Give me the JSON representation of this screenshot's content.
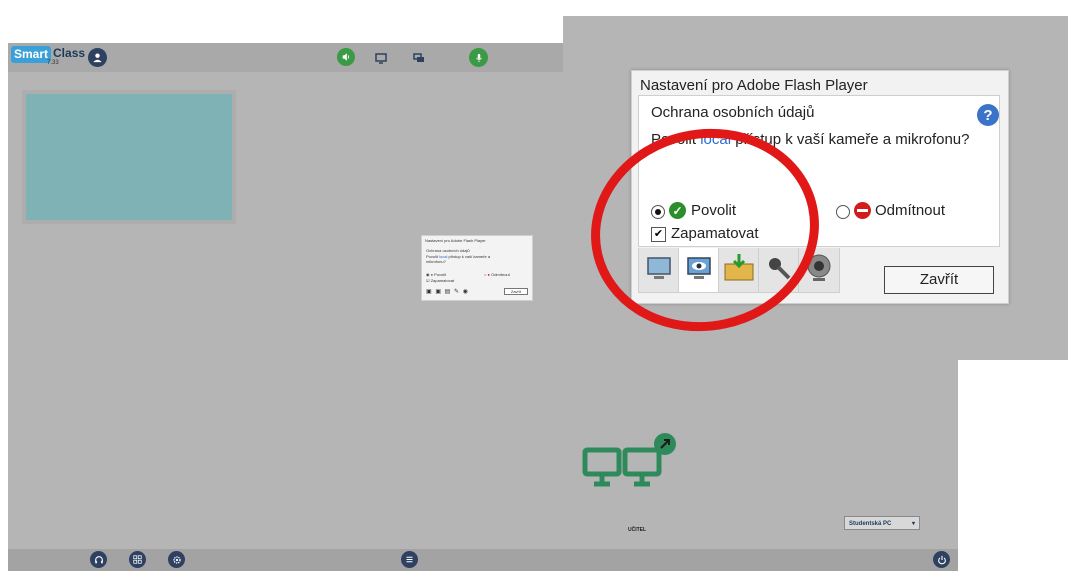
{
  "app": {
    "logo_primary": "Smart",
    "logo_secondary": "Class",
    "version": "7.33",
    "teacher_label": "UČITEL",
    "student_select": "Studentská PC",
    "student_select_arrow": "▾"
  },
  "icons": {
    "topbar": [
      "users-icon",
      "speaker-icon",
      "monitor-icon",
      "chat-icon",
      "microphone-icon"
    ],
    "bottombar": [
      "headset-icon",
      "grid-icon",
      "settings-icon",
      "list-icon",
      "power-icon"
    ]
  },
  "flash_dialog": {
    "title": "Nastavení pro Adobe Flash Player",
    "section": "Ochrana osobních údajů",
    "question_before": "Povolit ",
    "question_link": "local",
    "question_after": " přístup k vaší kameře a mikrofonu?",
    "allow": "Povolit",
    "deny": "Odmítnout",
    "remember": "Zapamatovat",
    "close": "Zavřít",
    "help": "?",
    "selected_option": "Povolit",
    "remember_checked": true
  },
  "mini_dialog": {
    "title": "Nastavení pro Adobe Flash Player",
    "section": "Ochrana osobních údajů",
    "line1_before": "Povolit ",
    "line1_link": "local",
    "line1_after": " přístup k vaší kameře a",
    "line2": "mikrofonu?",
    "allow": "Povolit",
    "deny": "Odmítnout",
    "remember": "Zapamatovat",
    "close": "Zavřít"
  },
  "colors": {
    "app_bg": "#b5b5b5",
    "accent_dark": "#2e4160",
    "accent_green": "#3a9a45",
    "teacher_green": "#2e8a5a",
    "highlight_red": "#e01818"
  }
}
